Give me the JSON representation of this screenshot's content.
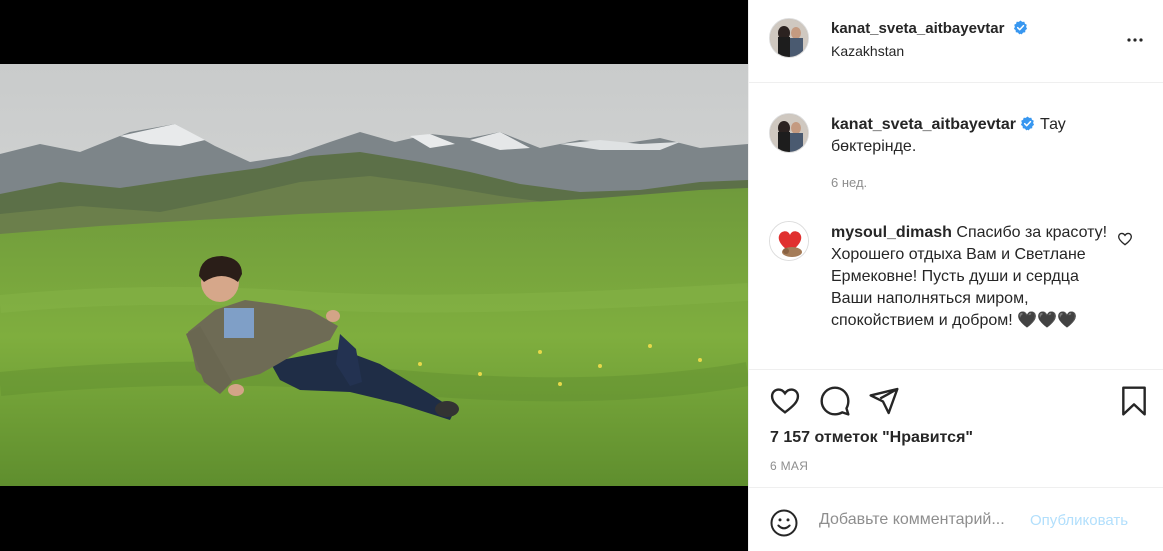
{
  "post": {
    "username": "kanat_sveta_aitbayevtar",
    "location": "Kazakhstan",
    "caption": "Тау бөктерінде.",
    "caption_age": "6 нед.",
    "likes": "7 157 отметок \"Нравится\"",
    "date": "6 МАЯ"
  },
  "comments": [
    {
      "username": "mysoul_dimash",
      "text": "Спасибо за красоту! Хорошего отдыха Вам и Светлане Ермековне! Пусть души и сердца Ваши наполняться миром, спокойствием и добром! 🖤🖤🖤"
    }
  ],
  "add_comment": {
    "placeholder": "Добавьте комментарий...",
    "post_label": "Опубликовать"
  },
  "icons": {
    "verified": "verified-badge-icon",
    "more": "more-options-icon",
    "like": "heart-icon",
    "comment": "comment-icon",
    "share": "share-icon",
    "save": "bookmark-icon",
    "emoji": "emoji-icon"
  },
  "colors": {
    "verified_blue": "#3897f0",
    "post_button_disabled": "#b2dffc",
    "secondary_text": "#8e8e8e"
  }
}
